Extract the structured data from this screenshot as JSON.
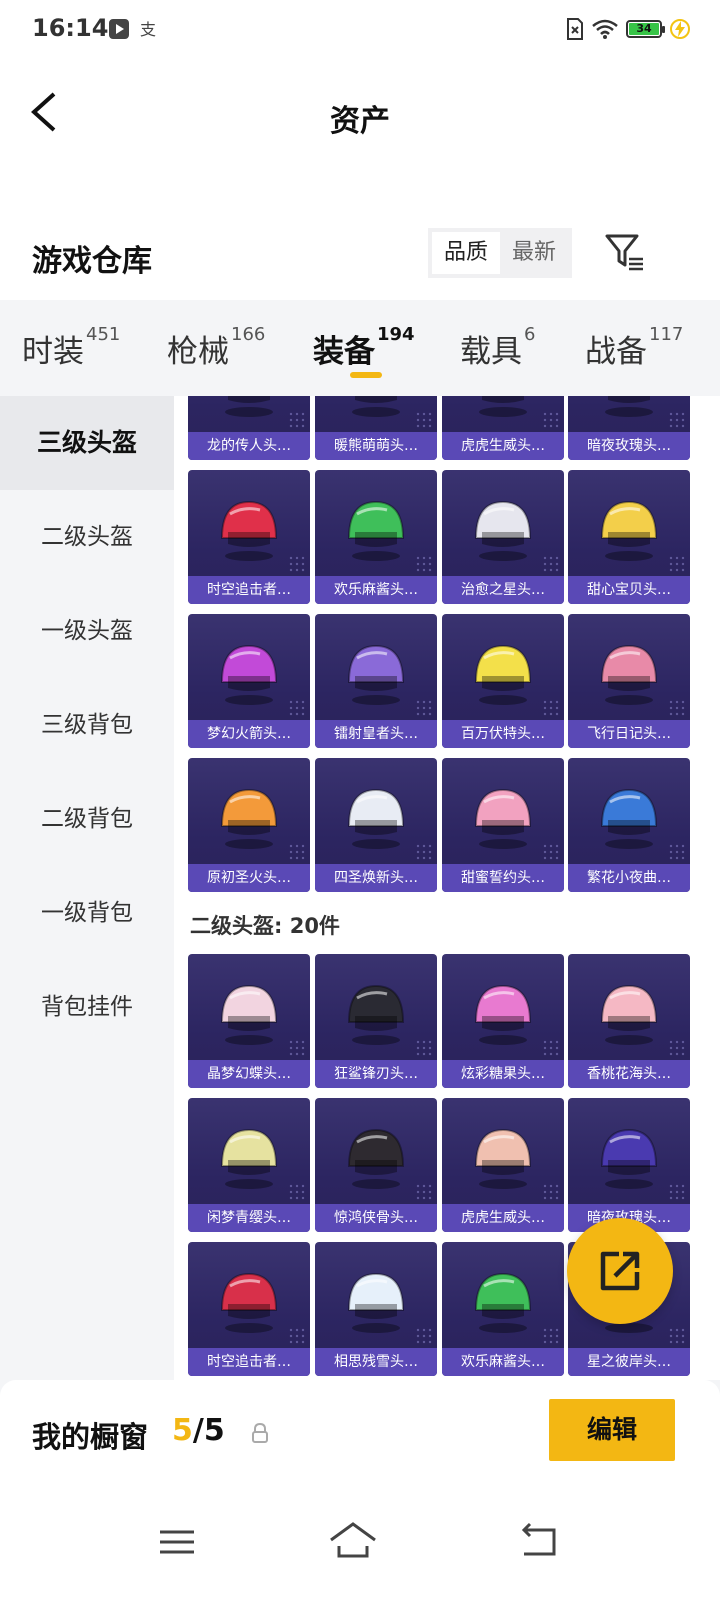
{
  "status_bar": {
    "time": "16:14",
    "battery": "34"
  },
  "header": {
    "title": "资产",
    "section_title": "游戏仓库"
  },
  "sort": {
    "options": [
      "品质",
      "最新"
    ],
    "selected": "品质"
  },
  "tabs": [
    {
      "label": "时装",
      "count": "451"
    },
    {
      "label": "枪械",
      "count": "166"
    },
    {
      "label": "装备",
      "count": "194"
    },
    {
      "label": "载具",
      "count": "6"
    },
    {
      "label": "战备",
      "count": "117"
    }
  ],
  "active_tab": "装备",
  "sidebar": {
    "items": [
      "三级头盔",
      "二级头盔",
      "一级头盔",
      "三级背包",
      "二级背包",
      "一级背包",
      "背包挂件"
    ],
    "selected": "三级头盔"
  },
  "groups": [
    {
      "header": "",
      "items": [
        {
          "name": "龙的传人头…",
          "color": "#d94a3a"
        },
        {
          "name": "暖熊萌萌头…",
          "color": "#f0b84a"
        },
        {
          "name": "虎虎生威头…",
          "color": "#e05a3a"
        },
        {
          "name": "暗夜玫瑰头…",
          "color": "#3a5ab0"
        },
        {
          "name": "时空追击者…",
          "color": "#e0304a"
        },
        {
          "name": "欢乐麻酱头…",
          "color": "#3fbf5a"
        },
        {
          "name": "治愈之星头…",
          "color": "#e6e6ee"
        },
        {
          "name": "甜心宝贝头…",
          "color": "#f3cf4a"
        },
        {
          "name": "梦幻火箭头…",
          "color": "#c24ad8"
        },
        {
          "name": "镭射皇者头…",
          "color": "#8a6ad8"
        },
        {
          "name": "百万伏特头…",
          "color": "#f3e04a"
        },
        {
          "name": "飞行日记头…",
          "color": "#e88aa8"
        },
        {
          "name": "原初圣火头…",
          "color": "#f39a3a"
        },
        {
          "name": "四圣焕新头…",
          "color": "#e8ecf4"
        },
        {
          "name": "甜蜜誓约头…",
          "color": "#f2a2c0"
        },
        {
          "name": "繁花小夜曲…",
          "color": "#3a7ad8"
        }
      ]
    },
    {
      "header": "二级头盔: 20件",
      "items": [
        {
          "name": "晶梦幻蝶头…",
          "color": "#f2d4e0"
        },
        {
          "name": "狂鲨锋刃头…",
          "color": "#2a2a33"
        },
        {
          "name": "炫彩糖果头…",
          "color": "#e87ad0"
        },
        {
          "name": "香桃花海头…",
          "color": "#f5b8c4"
        },
        {
          "name": "闲梦青缨头…",
          "color": "#e6e2a0"
        },
        {
          "name": "惊鸿侠骨头…",
          "color": "#2e2a30"
        },
        {
          "name": "虎虎生威头…",
          "color": "#f0c0b0"
        },
        {
          "name": "暗夜玫瑰头…",
          "color": "#4a3ab0"
        },
        {
          "name": "时空追击者…",
          "color": "#d8304a"
        },
        {
          "name": "相思残雪头…",
          "color": "#e6f0fa"
        },
        {
          "name": "欢乐麻酱头…",
          "color": "#3fbf5a"
        },
        {
          "name": "星之彼岸头…",
          "color": "#5a80e0"
        }
      ]
    }
  ],
  "showcase": {
    "label": "我的橱窗",
    "current": "5",
    "total": "/5",
    "edit": "编辑"
  }
}
